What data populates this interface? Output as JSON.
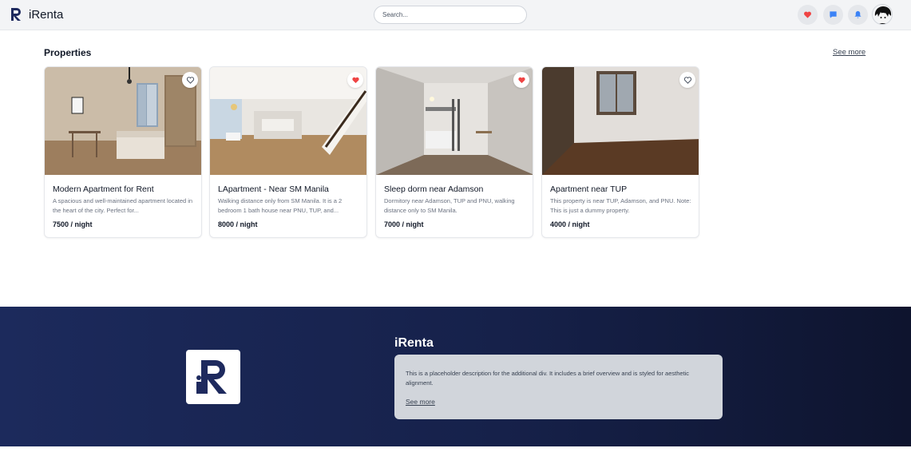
{
  "header": {
    "brand": "iRenta",
    "search_placeholder": "Search..."
  },
  "properties": {
    "title": "Properties",
    "see_more": "See more",
    "cards": [
      {
        "title": "Modern Apartment for Rent",
        "description": "A spacious and well-maintained apartment located in the heart of the city. Perfect for...",
        "price": "7500 / night",
        "favorited": false
      },
      {
        "title": "LApartment - Near SM Manila",
        "description": "Walking distance only from SM Manila. It is a 2 bedroom 1 bath house near PNU, TUP, and...",
        "price": "8000 / night",
        "favorited": true
      },
      {
        "title": "Sleep dorm near Adamson",
        "description": "Dormitory near Adamson, TUP and PNU, walking distance only to SM Manila.",
        "price": "7000 / night",
        "favorited": true
      },
      {
        "title": "Apartment near TUP",
        "description": "This property is near TUP, Adamson, and PNU. Note: This is just a dummy property.",
        "price": "4000 / night",
        "favorited": false
      }
    ]
  },
  "footer": {
    "title": "iRenta",
    "description": "This is a placeholder description for the additional div. It includes a brief overview and is styled for aesthetic alignment.",
    "link": "See more"
  },
  "colors": {
    "accent_red": "#ef4444",
    "accent_blue": "#3b82f6",
    "footer_navy": "#1c2a5c"
  },
  "icons": [
    "heart-icon",
    "chat-icon",
    "bell-icon",
    "avatar"
  ]
}
